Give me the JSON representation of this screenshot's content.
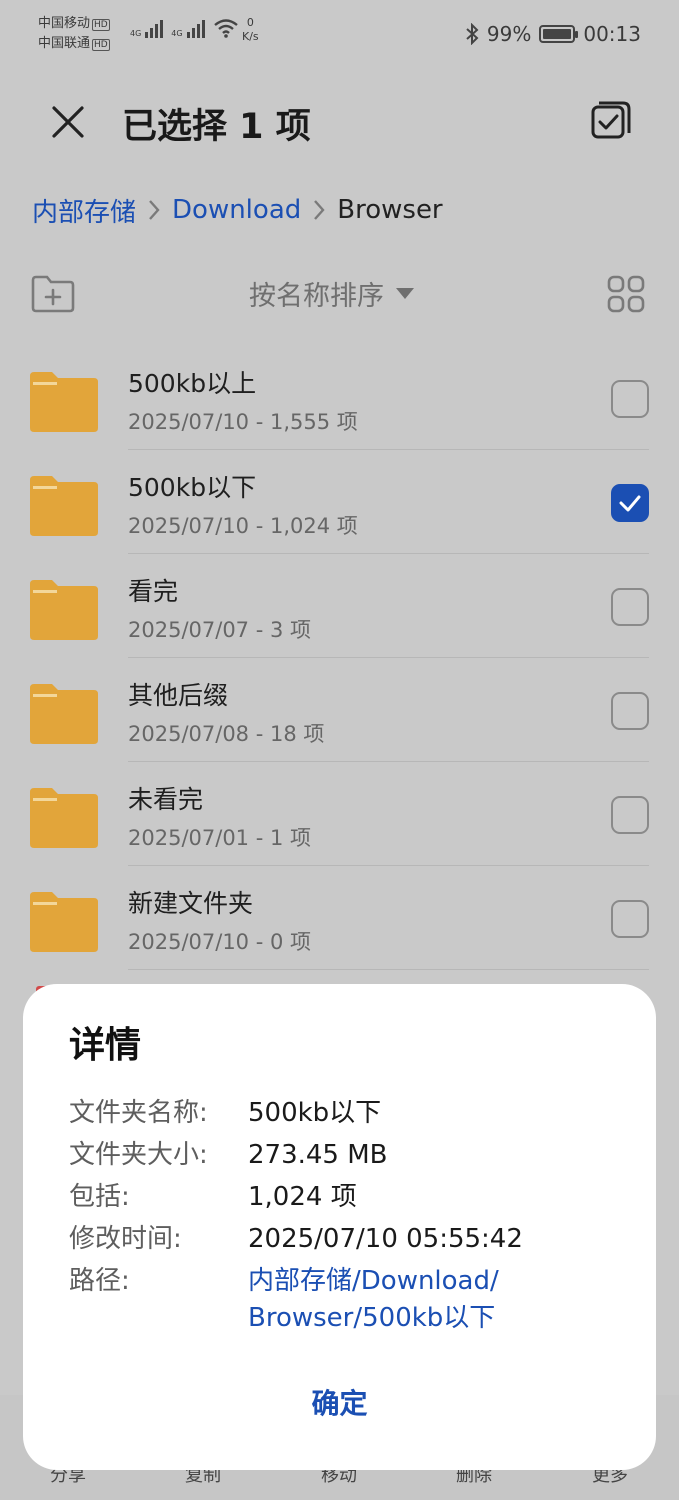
{
  "status_bar": {
    "carrier1": "中国移动",
    "carrier2": "中国联通",
    "hd": "HD",
    "net_type": "4G",
    "speed_value": "0",
    "speed_unit": "K/s",
    "battery_percent": "99%",
    "battery_level": 0.99,
    "time": "00:13"
  },
  "header": {
    "title": "已选择 1 项"
  },
  "breadcrumb": {
    "items": [
      "内部存储",
      "Download",
      "Browser"
    ]
  },
  "toolbar": {
    "sort_label": "按名称排序"
  },
  "files": [
    {
      "name": "500kb以上",
      "meta": "2025/07/10 - 1,555 项",
      "checked": false
    },
    {
      "name": "500kb以下",
      "meta": "2025/07/10 - 1,024 项",
      "checked": true
    },
    {
      "name": "看完",
      "meta": "2025/07/07 - 3 项",
      "checked": false
    },
    {
      "name": "其他后缀",
      "meta": "2025/07/08 - 18 项",
      "checked": false
    },
    {
      "name": "未看完",
      "meta": "2025/07/01 - 1 项",
      "checked": false
    },
    {
      "name": "新建文件夹",
      "meta": "2025/07/10 - 0 项",
      "checked": false
    }
  ],
  "bottom_bar": {
    "share": "分享",
    "copy": "复制",
    "move": "移动",
    "delete": "删除",
    "more": "更多"
  },
  "dialog": {
    "title": "详情",
    "rows": [
      {
        "label": "文件夹名称:",
        "value": "500kb以下"
      },
      {
        "label": "文件夹大小:",
        "value": "273.45 MB"
      },
      {
        "label": "包括:",
        "value": "1,024 项"
      },
      {
        "label": "修改时间:",
        "value": "2025/07/10 05:55:42"
      }
    ],
    "path_label": "路径:",
    "path_line1": "内部存储/Download/",
    "path_line2": "Browser/500kb以下",
    "ok_label": "确定"
  },
  "colors": {
    "accent": "#1b4fb3",
    "folder": "#e2a53a",
    "dim_background": "#c9c9c9"
  }
}
